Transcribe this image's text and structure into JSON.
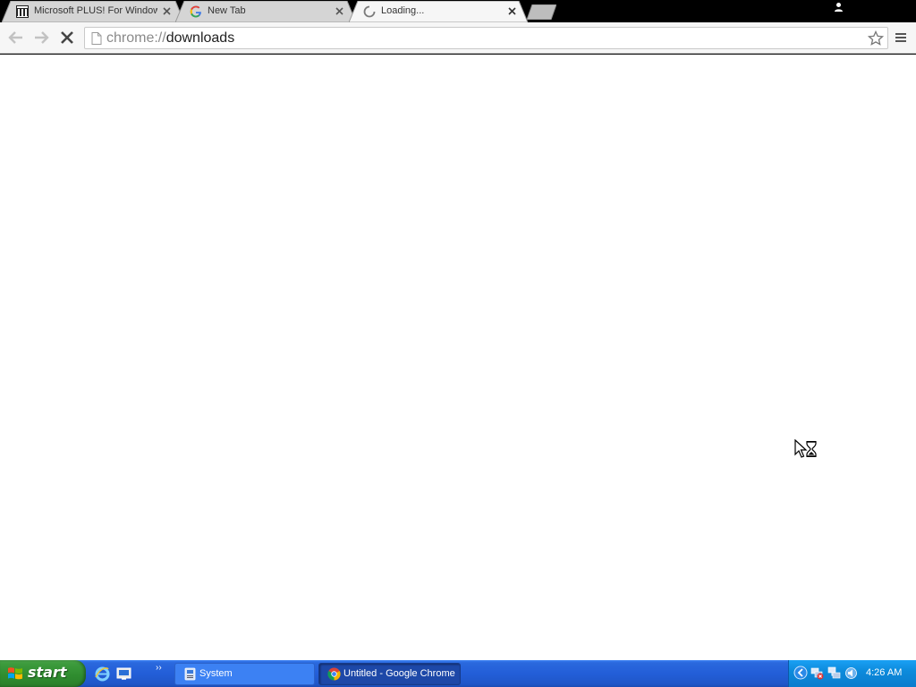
{
  "tabs": [
    {
      "title": "Microsoft PLUS! For Window",
      "icon": "archive-icon",
      "active": false
    },
    {
      "title": "New Tab",
      "icon": "google-icon",
      "active": false
    },
    {
      "title": "Loading...",
      "icon": "spinner-icon",
      "active": true
    }
  ],
  "toolbar": {
    "url_scheme": "chrome://",
    "url_host": "downloads"
  },
  "taskbar": {
    "start_label": "start",
    "tasks": [
      {
        "label": "System",
        "icon": "system-icon",
        "active": false
      },
      {
        "label": "Untitled - Google Chrome",
        "icon": "chrome-icon",
        "active": true
      }
    ],
    "clock": "4:26 AM"
  },
  "colors": {
    "taskbar_blue": "#235ed8",
    "start_green": "#3c9a3c",
    "tray_blue": "#0d8bdc"
  }
}
